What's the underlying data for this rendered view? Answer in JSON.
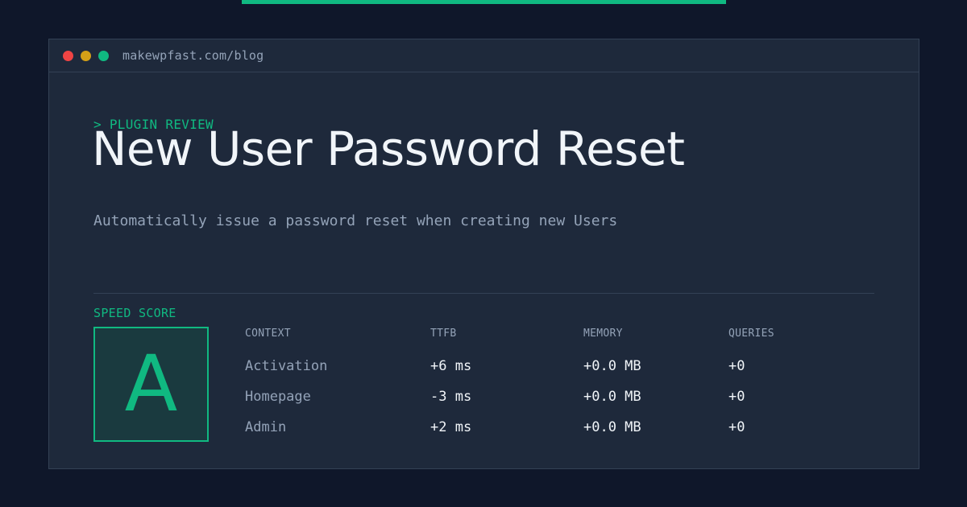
{
  "window": {
    "url": "makewpfast.com/blog"
  },
  "hero": {
    "eyebrow": "> PLUGIN REVIEW",
    "title": "New User Password Reset",
    "description": "Automatically issue a password reset when creating new Users"
  },
  "score": {
    "label": "SPEED SCORE",
    "grade": "A"
  },
  "metrics": {
    "headers": [
      "CONTEXT",
      "TTFB",
      "MEMORY",
      "QUERIES"
    ],
    "rows": [
      {
        "context": "Activation",
        "ttfb": "+6 ms",
        "memory": "+0.0 MB",
        "queries": "+0"
      },
      {
        "context": "Homepage",
        "ttfb": "-3 ms",
        "memory": "+0.0 MB",
        "queries": "+0"
      },
      {
        "context": "Admin",
        "ttfb": "+2 ms",
        "memory": "+0.0 MB",
        "queries": "+0"
      }
    ]
  },
  "colors": {
    "accent": "#10b981",
    "background": "#0f172a",
    "panel": "#1e293b",
    "muted_text": "#94a3b8",
    "primary_text": "#f1f5f9"
  },
  "icons": [
    "close-dot-icon",
    "minimize-dot-icon",
    "maximize-dot-icon"
  ]
}
